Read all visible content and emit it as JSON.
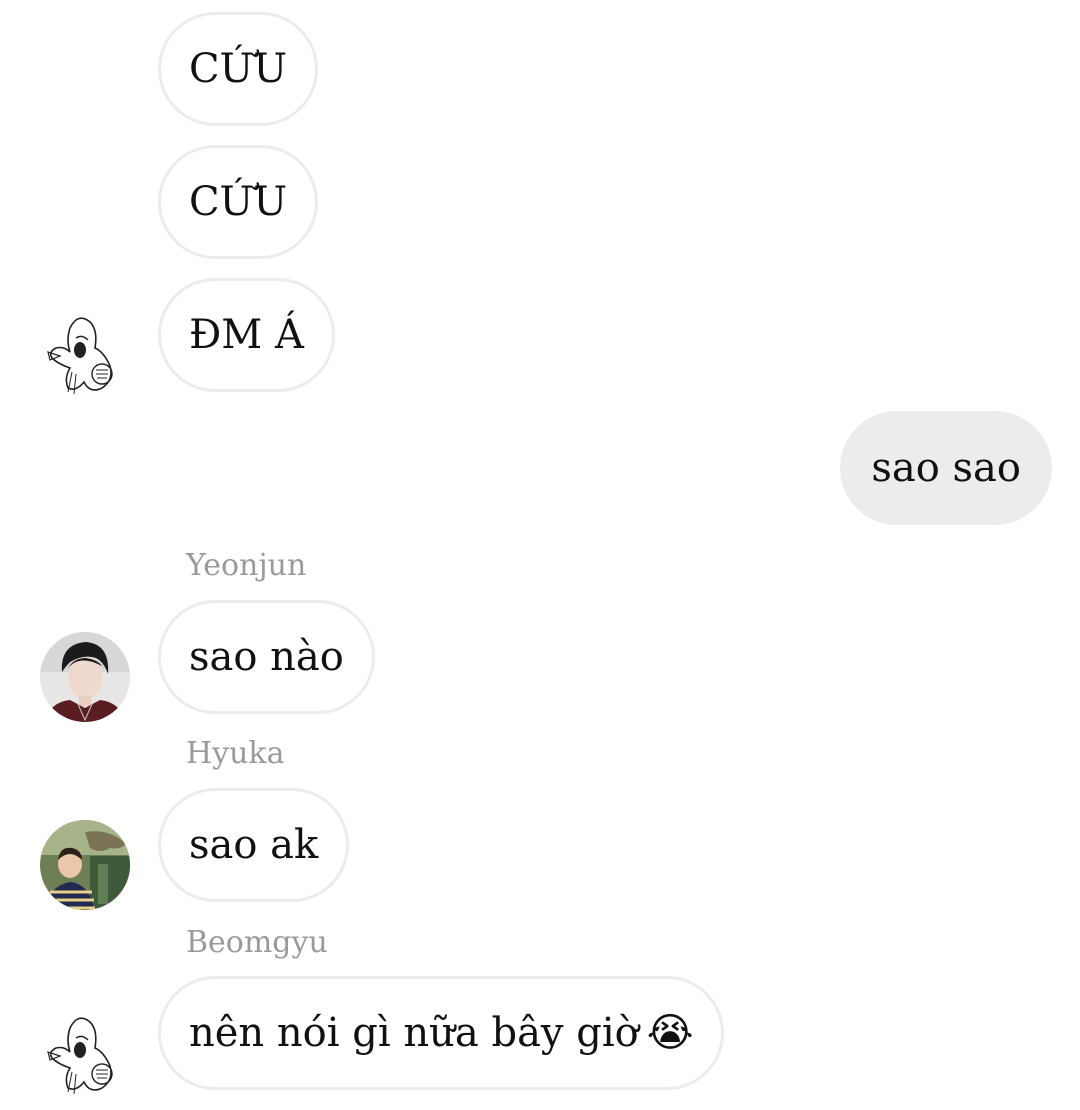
{
  "messages": [
    {
      "text": "CỨU",
      "direction": "incoming"
    },
    {
      "text": "CỨU",
      "direction": "incoming"
    },
    {
      "text": "ĐM Á",
      "direction": "incoming"
    },
    {
      "text": "sao sao",
      "direction": "outgoing"
    },
    {
      "sender": "Yeonjun",
      "text": "sao nào",
      "direction": "incoming"
    },
    {
      "sender": "Hyuka",
      "text": "sao ak",
      "direction": "incoming"
    },
    {
      "sender": "Beomgyu",
      "text": "nên nói gì nữa bây giờ",
      "emoji": "😭",
      "direction": "incoming"
    }
  ],
  "avatars": {
    "meme": "meme-sketch-avatar",
    "yeonjun": "yeonjun-photo-avatar",
    "hyuka": "hyuka-photo-avatar"
  },
  "colors": {
    "incoming_bubble": "#ffffff",
    "incoming_border": "#ececec",
    "outgoing_bubble": "#ececec",
    "text": "#111111",
    "sender_name": "#9a9a9a"
  }
}
